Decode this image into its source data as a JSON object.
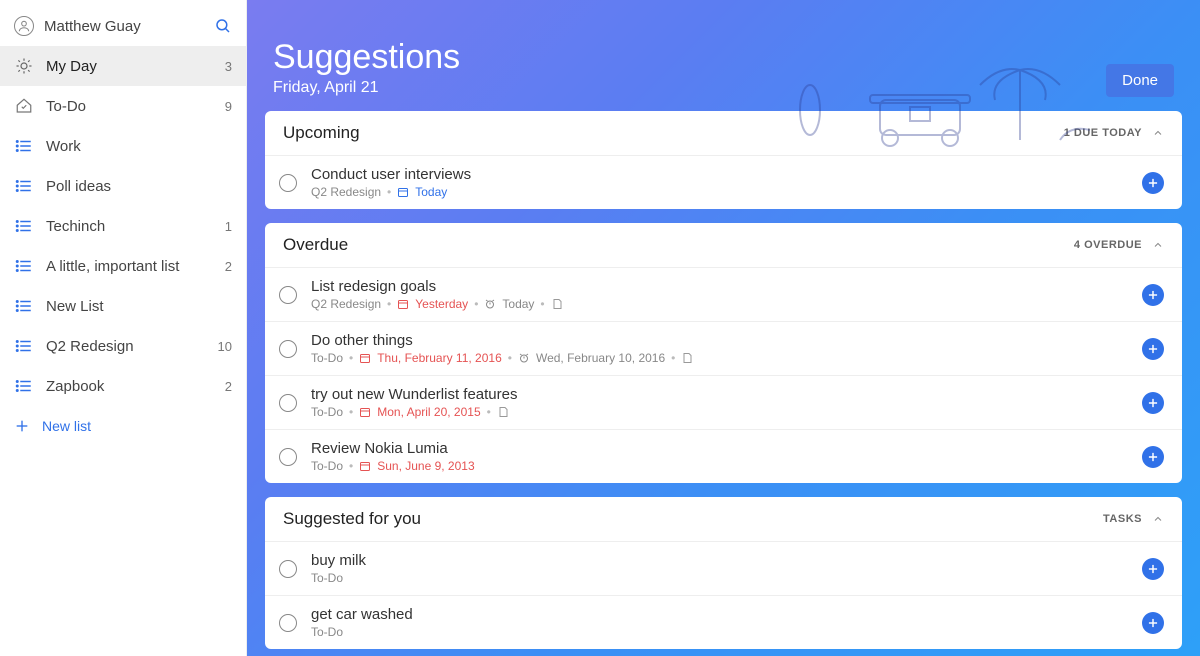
{
  "user": {
    "name": "Matthew Guay"
  },
  "sidebar": {
    "items": [
      {
        "label": "My Day",
        "count": "3",
        "icon": "sun",
        "active": true
      },
      {
        "label": "To-Do",
        "count": "9",
        "icon": "todo"
      },
      {
        "label": "Work",
        "count": "",
        "icon": "list"
      },
      {
        "label": "Poll ideas",
        "count": "",
        "icon": "list"
      },
      {
        "label": "Techinch",
        "count": "1",
        "icon": "list"
      },
      {
        "label": "A little, important list",
        "count": "2",
        "icon": "list"
      },
      {
        "label": "New List",
        "count": "",
        "icon": "list"
      },
      {
        "label": "Q2 Redesign",
        "count": "10",
        "icon": "list"
      },
      {
        "label": "Zapbook",
        "count": "2",
        "icon": "list"
      }
    ],
    "new_list_label": "New list"
  },
  "header": {
    "title": "Suggestions",
    "date": "Friday, April 21",
    "done_label": "Done"
  },
  "sections": {
    "upcoming": {
      "title": "Upcoming",
      "badge": "1 DUE TODAY",
      "tasks": [
        {
          "title": "Conduct user interviews",
          "list": "Q2 Redesign",
          "due": "Today",
          "due_red": false
        }
      ]
    },
    "overdue": {
      "title": "Overdue",
      "badge": "4 OVERDUE",
      "tasks": [
        {
          "title": "List redesign goals",
          "list": "Q2 Redesign",
          "due": "Yesterday",
          "reminder": "Today",
          "has_note": true
        },
        {
          "title": "Do other things",
          "list": "To-Do",
          "due": "Thu, February 11, 2016",
          "reminder": "Wed, February 10, 2016",
          "has_note": true
        },
        {
          "title": "try out new Wunderlist features",
          "list": "To-Do",
          "due": "Mon, April 20, 2015",
          "has_note": true
        },
        {
          "title": "Review Nokia Lumia",
          "list": "To-Do",
          "due": "Sun, June 9, 2013"
        }
      ]
    },
    "suggested": {
      "title": "Suggested for you",
      "badge": "TASKS",
      "tasks": [
        {
          "title": "buy milk",
          "list": "To-Do"
        },
        {
          "title": "get car washed",
          "list": "To-Do"
        }
      ]
    }
  }
}
